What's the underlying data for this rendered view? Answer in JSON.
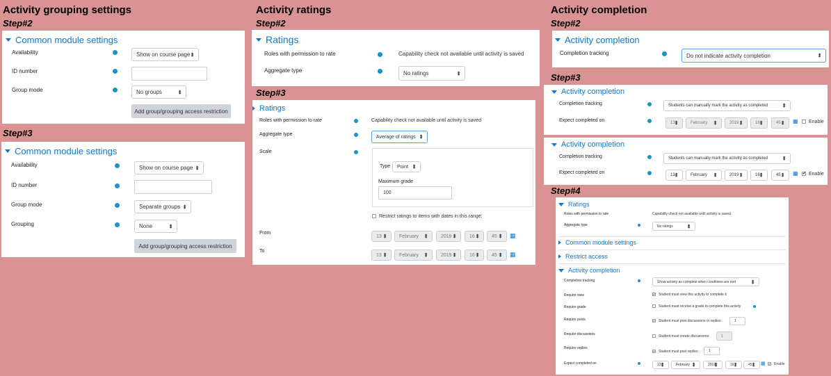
{
  "headings": {
    "grouping": "Activity grouping settings",
    "ratings": "Activity ratings",
    "completion": "Activity completion"
  },
  "steps": {
    "s2": "Step#2",
    "s3": "Step#3",
    "s4": "Step#4"
  },
  "labels": {
    "common_module_settings": "Common module settings",
    "availability": "Availability",
    "id_number": "ID number",
    "group_mode": "Group mode",
    "grouping": "Grouping",
    "ratings": "Ratings",
    "roles_permission": "Roles with permission to rate",
    "aggregate_type": "Aggregate type",
    "scale": "Scale",
    "type": "Type",
    "maximum_grade": "Maximum grade",
    "from": "From",
    "to": "To",
    "activity_completion": "Activity completion",
    "completion_tracking": "Completion tracking",
    "expect_completed_on": "Expect completed on",
    "restrict_access": "Restrict access",
    "require_view": "Require view",
    "require_grade": "Require grade",
    "require_posts": "Require posts",
    "require_discussions": "Require discussions",
    "require_replies": "Require replies",
    "enable": "Enable"
  },
  "values": {
    "show_on_course_page": "Show on course page",
    "no_groups": "No groups",
    "separate_groups": "Separate groups",
    "none": "None",
    "add_restriction": "Add group/grouping access restriction",
    "capability_msg": "Capability check not available until activity is saved",
    "no_ratings": "No ratings",
    "average_of_ratings": "Average of ratings",
    "point": "Point",
    "max_grade": "100",
    "restrict_dates": "Restrict ratings to items with dates in this range:",
    "day": "13",
    "month": "February",
    "year": "2019",
    "hour": "16",
    "minute": "45",
    "do_not_indicate": "Do not indicate activity completion",
    "manual_mark": "Students can manually mark the activity as completed",
    "show_complete_when": "Show activity as complete when conditions are met",
    "must_view": "Student must view this activity to complete it",
    "must_grade": "Student must receive a grade to complete this activity",
    "must_post": "Student must post discussions or replies:",
    "posts_count": "1",
    "must_create_discussions": "Student must create discussions:",
    "discussions_count": "1",
    "must_post_replies": "Student must post replies:",
    "replies_count": "1",
    "check": "✔"
  },
  "colors": {
    "background": "#d99392",
    "accent": "#1177d1",
    "help": "#1a93c6"
  }
}
